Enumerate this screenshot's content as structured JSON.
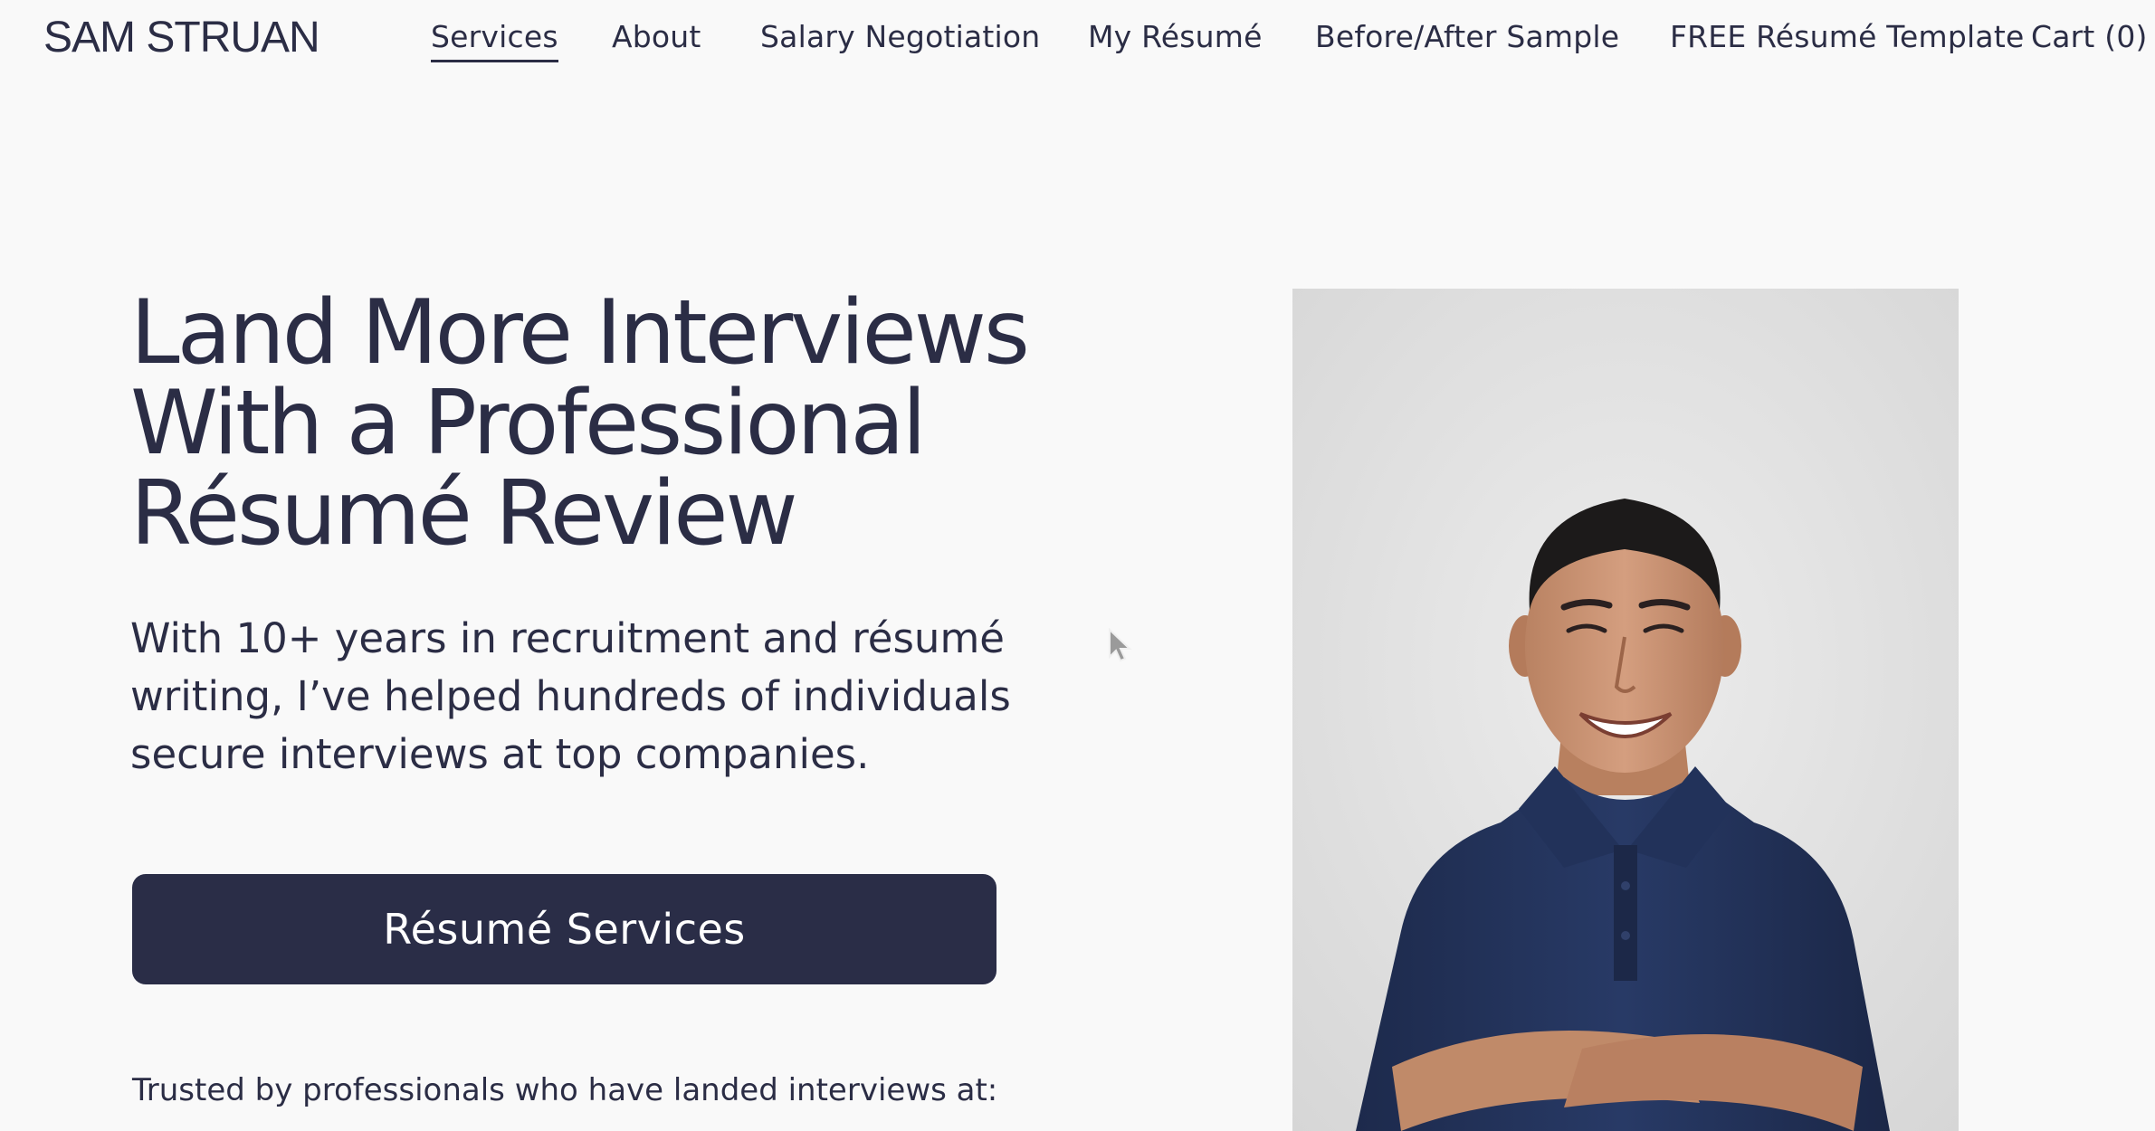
{
  "header": {
    "brand": "SAM STRUAN",
    "nav": [
      {
        "label": "Services",
        "active": true
      },
      {
        "label": "About",
        "active": false
      },
      {
        "label": "Salary Negotiation",
        "active": false
      },
      {
        "label": "My Résumé",
        "active": false
      },
      {
        "label": "Before/After Sample",
        "active": false
      },
      {
        "label": "FREE Résumé Template",
        "active": false
      },
      {
        "label": "Cart (0)",
        "active": false
      }
    ]
  },
  "hero": {
    "title_lines": [
      "Land More Interviews",
      "With a Professional",
      "Résumé Review"
    ],
    "subtitle_lines": [
      "With 10+ years in recruitment and résumé",
      "writing, I’ve helped hundreds of individuals",
      "secure interviews at top companies."
    ],
    "cta_label": "Résumé Services",
    "trusted_text": "Trusted by professionals who have landed interviews at:"
  },
  "colors": {
    "background": "#f9f9f9",
    "text": "#2b2d45",
    "button": "#2a2d47",
    "button_text": "#ffffff"
  },
  "icons": {
    "cursor": "mouse-pointer-icon"
  }
}
